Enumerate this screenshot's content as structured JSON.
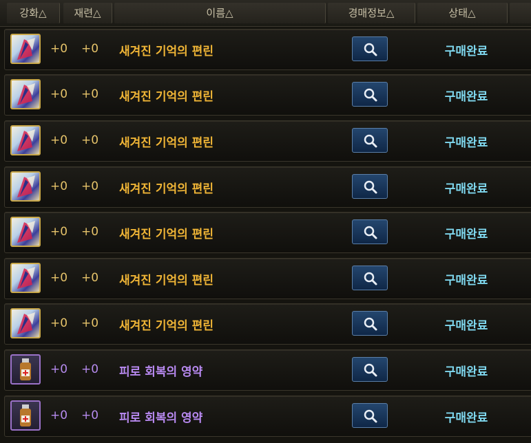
{
  "header": {
    "columns": [
      {
        "label": "강화△"
      },
      {
        "label": "재련△"
      },
      {
        "label": "이름△"
      },
      {
        "label": "경매정보△"
      },
      {
        "label": "상태△"
      }
    ]
  },
  "colors": {
    "gold_text": "#f0b536",
    "purple_text": "#b98af2",
    "status_text": "#7fd8ef",
    "button_blue": "#1c3b62"
  },
  "rows": [
    {
      "icon": "fragment-icon",
      "enhance": "+0",
      "refine": "+0",
      "name": "새겨진 기억의 편린",
      "status": "구매완료",
      "rarity": "gold"
    },
    {
      "icon": "fragment-icon",
      "enhance": "+0",
      "refine": "+0",
      "name": "새겨진 기억의 편린",
      "status": "구매완료",
      "rarity": "gold"
    },
    {
      "icon": "fragment-icon",
      "enhance": "+0",
      "refine": "+0",
      "name": "새겨진 기억의 편린",
      "status": "구매완료",
      "rarity": "gold"
    },
    {
      "icon": "fragment-icon",
      "enhance": "+0",
      "refine": "+0",
      "name": "새겨진 기억의 편린",
      "status": "구매완료",
      "rarity": "gold"
    },
    {
      "icon": "fragment-icon",
      "enhance": "+0",
      "refine": "+0",
      "name": "새겨진 기억의 편린",
      "status": "구매완료",
      "rarity": "gold"
    },
    {
      "icon": "fragment-icon",
      "enhance": "+0",
      "refine": "+0",
      "name": "새겨진 기억의 편린",
      "status": "구매완료",
      "rarity": "gold"
    },
    {
      "icon": "fragment-icon",
      "enhance": "+0",
      "refine": "+0",
      "name": "새겨진 기억의 편린",
      "status": "구매완료",
      "rarity": "gold"
    },
    {
      "icon": "potion-icon",
      "enhance": "+0",
      "refine": "+0",
      "name": "피로 회복의 영약",
      "status": "구매완료",
      "rarity": "purple"
    },
    {
      "icon": "potion-icon",
      "enhance": "+0",
      "refine": "+0",
      "name": "피로 회복의 영약",
      "status": "구매완료",
      "rarity": "purple"
    }
  ],
  "search_icon": "search-icon"
}
